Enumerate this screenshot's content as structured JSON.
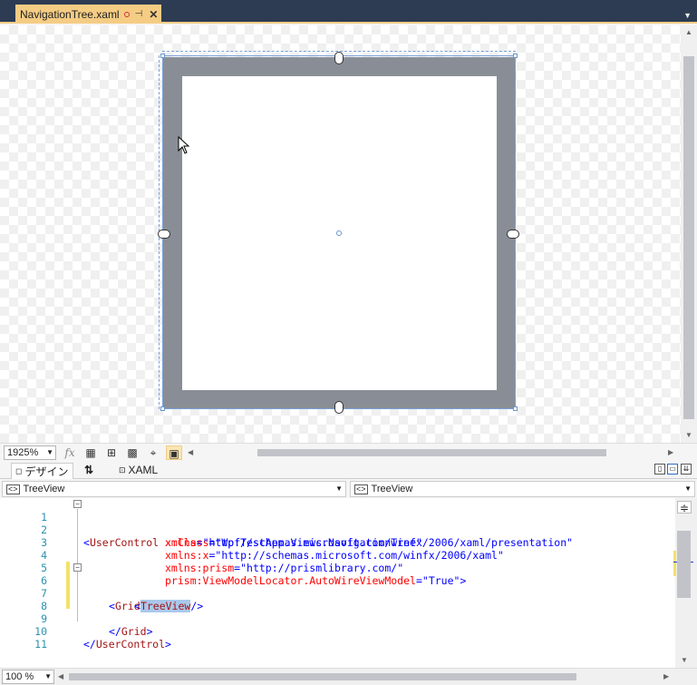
{
  "tab": {
    "title": "NavigationTree.xaml",
    "pin": "⊣",
    "close": "✕"
  },
  "designer": {
    "zoom": "1925%",
    "fx_label": "fx"
  },
  "switchbar": {
    "design_label": "デザイン",
    "swap_label": "⇅",
    "xaml_label": "XAML"
  },
  "navbar": {
    "left_element": "TreeView",
    "right_element": "TreeView"
  },
  "editor": {
    "zoom": "100 %",
    "lines": [
      {
        "n": "1"
      },
      {
        "n": "2"
      },
      {
        "n": "3"
      },
      {
        "n": "4"
      },
      {
        "n": "5"
      },
      {
        "n": "6"
      },
      {
        "n": "7"
      },
      {
        "n": "8"
      },
      {
        "n": "9"
      },
      {
        "n": "10"
      },
      {
        "n": "11"
      }
    ],
    "code": {
      "l1_open": "<",
      "l1_tag": "UserControl",
      "l1_attr": " x:Class",
      "l1_eq": "=",
      "l1_val": "\"WpfTestApp.Views.NavigationTree\"",
      "l2_attr": "xmlns",
      "l2_val": "\"http://schemas.microsoft.com/winfx/2006/xaml/presentation\"",
      "l3_attr": "xmlns:x",
      "l3_val": "\"http://schemas.microsoft.com/winfx/2006/xaml\"",
      "l4_attr": "xmlns:prism",
      "l4_val": "\"http://prismlibrary.com/\"",
      "l5_attr": "prism:ViewModelLocator.AutoWireViewModel",
      "l5_val": "\"True\"",
      "l5_close": ">",
      "l6_tag": "Grid",
      "l7_tag": "TreeView",
      "l9_tag": "Grid",
      "l10_tag": "UserControl"
    }
  },
  "colors": {
    "tabbar": "#2d3b53",
    "tab_active": "#f5cc84",
    "control_border": "#898e96",
    "keyword_blue": "#0000ff",
    "tag_brown": "#a31515",
    "attr_red": "#ff0000",
    "line_number": "#2b91af"
  }
}
